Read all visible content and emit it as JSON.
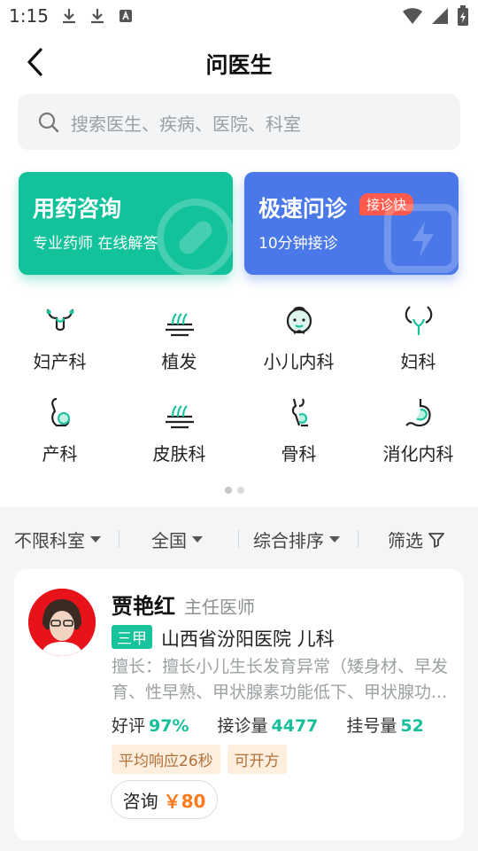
{
  "status_bar": {
    "time": "1:15"
  },
  "header": {
    "title": "问医生"
  },
  "search": {
    "placeholder": "搜索医生、疾病、医院、科室"
  },
  "promo": [
    {
      "title": "用药咨询",
      "subtitle": "专业药师 在线解答",
      "color": "#11c29a"
    },
    {
      "title": "极速问诊",
      "subtitle": "10分钟接诊",
      "badge": "接诊快",
      "color": "#4a78e8"
    }
  ],
  "categories": [
    {
      "label": "妇产科",
      "icon": "uterus-icon"
    },
    {
      "label": "植发",
      "icon": "hair-icon"
    },
    {
      "label": "小儿内科",
      "icon": "baby-icon"
    },
    {
      "label": "妇科",
      "icon": "ovary-icon"
    },
    {
      "label": "产科",
      "icon": "pregnancy-icon"
    },
    {
      "label": "皮肤科",
      "icon": "skin-icon"
    },
    {
      "label": "骨科",
      "icon": "bone-icon"
    },
    {
      "label": "消化内科",
      "icon": "stomach-icon"
    }
  ],
  "filters": [
    "不限科室",
    "全国",
    "综合排序",
    "筛选"
  ],
  "doctor": {
    "name": "贾艳红",
    "title": "主任医师",
    "level": "三甲",
    "hospital": "山西省汾阳医院 儿科",
    "specialty": "擅长：擅长小儿生长发育异常（矮身材、早发育、性早熟、甲状腺素功能低下、甲状腺功...",
    "stats": [
      {
        "label": "好评",
        "value": "97%"
      },
      {
        "label": "接诊量",
        "value": "4477"
      },
      {
        "label": "挂号量",
        "value": "52"
      }
    ],
    "tags": [
      "平均响应26秒",
      "可开方"
    ],
    "consult_label": "咨询",
    "consult_price": "￥80"
  },
  "accent_color": "#17c09b"
}
